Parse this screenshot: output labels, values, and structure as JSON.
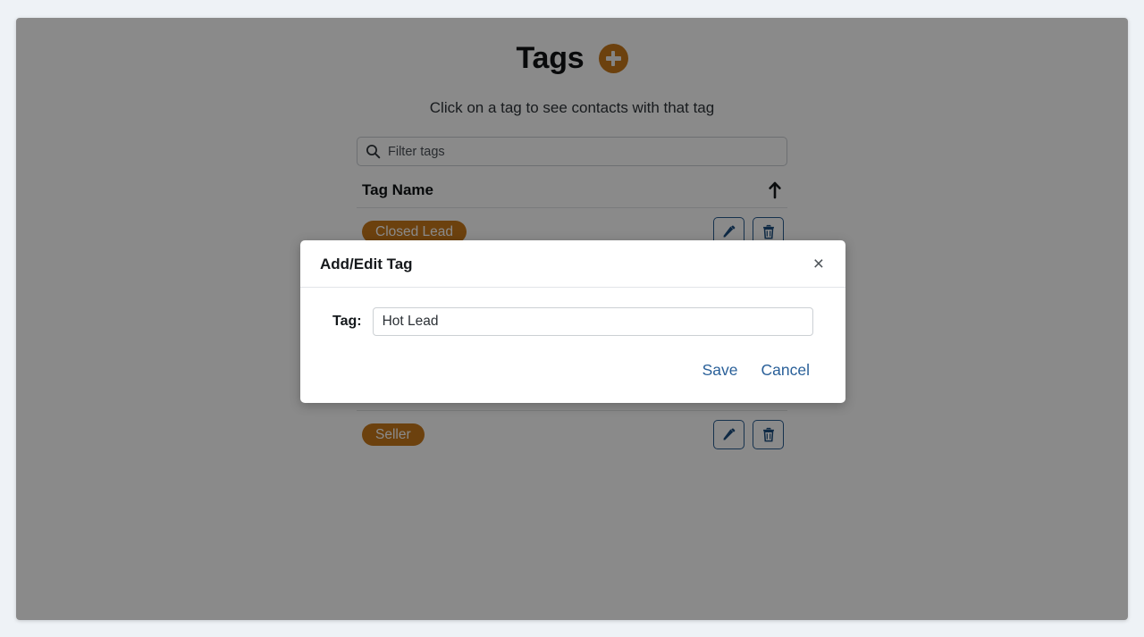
{
  "page": {
    "title": "Tags",
    "add_button_label": "+",
    "subtitle": "Click on a tag to see contacts with that tag"
  },
  "filter": {
    "placeholder": "Filter tags",
    "value": "",
    "icon": "search-icon"
  },
  "table": {
    "column_header": "Tag Name",
    "sort_direction_icon": "arrow-up-icon",
    "rows": [
      {
        "tag": "Closed Lead",
        "edit_icon": "pencil-icon",
        "delete_icon": "trash-icon"
      },
      {
        "tag": "Seller",
        "edit_icon": "pencil-icon",
        "delete_icon": "trash-icon"
      }
    ]
  },
  "modal": {
    "title": "Add/Edit Tag",
    "close_icon": "close-icon",
    "close_label": "×",
    "field_label": "Tag:",
    "field_value": "Hot Lead",
    "field_placeholder": "",
    "save_label": "Save",
    "cancel_label": "Cancel"
  },
  "colors": {
    "tag_accent": "#c8791b",
    "link_blue": "#2a6099",
    "icon_border_blue": "#2a5d91",
    "page_background": "#eef2f6",
    "backdrop": "rgba(0,0,0,0.46)"
  }
}
